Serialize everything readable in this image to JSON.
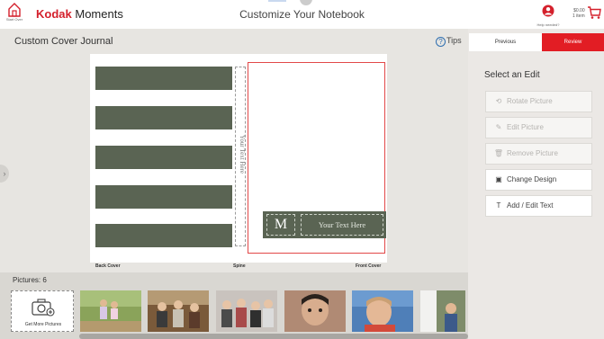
{
  "header": {
    "home_label": "Start Over",
    "brand_kodak": "Kodak",
    "brand_moments": "Moments",
    "page_title": "Customize Your Notebook",
    "help_label": "Help needed?",
    "cart_amount": "$0.00",
    "cart_items": "1 item"
  },
  "subheader": {
    "title": "Custom Cover Journal",
    "tips_label": "Tips"
  },
  "nav": {
    "previous_label": "Previous",
    "review_label": "Review"
  },
  "edit_panel": {
    "heading": "Select an Edit",
    "items": [
      {
        "label": "Rotate Picture",
        "icon": "rotate-icon",
        "enabled": false
      },
      {
        "label": "Edit Picture",
        "icon": "edit-icon",
        "enabled": false
      },
      {
        "label": "Remove Picture",
        "icon": "trash-icon",
        "enabled": false
      },
      {
        "label": "Change Design",
        "icon": "design-icon",
        "enabled": true
      },
      {
        "label": "Add / Edit Text",
        "icon": "text-icon",
        "enabled": true
      }
    ]
  },
  "canvas": {
    "spine_text": "Your Text Here",
    "monogram": "M",
    "front_text": "Your Text Here",
    "back_cover_label": "Back Cover",
    "spine_label": "Spine",
    "front_cover_label": "Front Cover",
    "stripe_color": "#5a6453",
    "selected_border_color": "#e24848"
  },
  "pictures": {
    "label": "Pictures: 6",
    "get_more_label": "Get More Pictures"
  },
  "colors": {
    "accent_red": "#e21d24",
    "brand_red": "#d4202c"
  }
}
